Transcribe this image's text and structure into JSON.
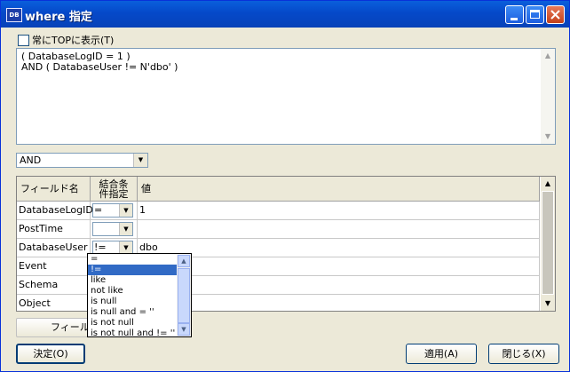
{
  "window": {
    "title": "where 指定",
    "icon_text": "DB"
  },
  "options": {
    "always_on_top_label": "常にTOPに表示(T)"
  },
  "where_text": {
    "line1": "( DatabaseLogID = 1 )",
    "line2": "AND ( DatabaseUser != N'dbo' )"
  },
  "combinator": {
    "selected": "AND"
  },
  "grid": {
    "headers": {
      "field": "フィールド名",
      "cond_line1": "結合条",
      "cond_line2": "件指定",
      "value": "値"
    },
    "rows": [
      {
        "field": "DatabaseLogID",
        "op": "=",
        "value": "1"
      },
      {
        "field": "PostTime",
        "op": "",
        "value": ""
      },
      {
        "field": "DatabaseUser",
        "op": "!=",
        "value": "dbo"
      },
      {
        "field": "Event",
        "op": "",
        "value": ""
      },
      {
        "field": "Schema",
        "op": "",
        "value": ""
      },
      {
        "field": "Object",
        "op": "",
        "value": ""
      }
    ]
  },
  "operator_dropdown": {
    "options": [
      "=",
      "!=",
      "like",
      "not like",
      "is null",
      "is null and = ''",
      "is not null",
      "is not null and != ''"
    ],
    "selected": "!="
  },
  "buttons": {
    "field_button": "フィールド",
    "ok": "決定(O)",
    "apply": "適用(A)",
    "close": "閉じる(X)"
  }
}
